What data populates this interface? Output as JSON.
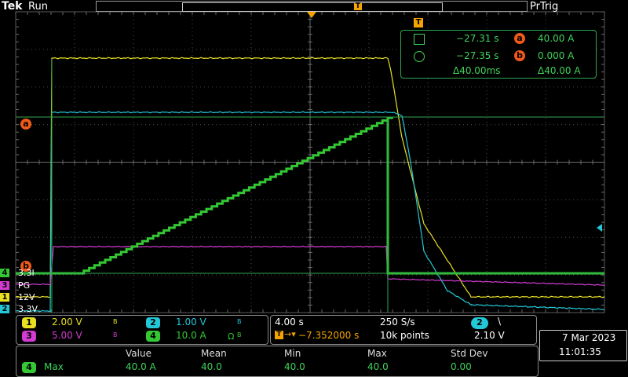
{
  "header": {
    "brand": "Tek",
    "run_state": "Run",
    "trigger_state": "PrTrig",
    "trigger_marker": "T"
  },
  "cursors": {
    "trigger_marker": "T",
    "a_label": "a",
    "b_label": "b",
    "a_time": "−27.31 s",
    "b_time": "−27.35 s",
    "a_value": "40.00 A",
    "b_value": "0.000 A",
    "delta_time": "Δ40.00ms",
    "delta_value": "Δ40.00 A"
  },
  "channel_labels": [
    {
      "num": "4",
      "text": "3.3I",
      "color": "#34c834"
    },
    {
      "num": "3",
      "text": "PG",
      "color": "#d33bd3"
    },
    {
      "num": "1",
      "text": "12V",
      "color": "#e8e020"
    },
    {
      "num": "2",
      "text": "3.3V",
      "color": "#22c8d8"
    }
  ],
  "channel_settings": [
    {
      "num": "1",
      "value": "2.00 V",
      "bw": "B",
      "color": "#e8e020"
    },
    {
      "num": "2",
      "value": "1.00 V",
      "bw": "B",
      "color": "#22c8d8"
    },
    {
      "num": "3",
      "value": "5.00 V",
      "bw": "B",
      "color": "#d33bd3"
    },
    {
      "num": "4",
      "value": "10.0 A",
      "bw": "B",
      "color": "#34c834"
    }
  ],
  "timebase": {
    "scale": "4.00 s",
    "sample_rate": "250 S/s",
    "trigger_offset": "−7.352000 s",
    "record_length": "10k points",
    "trigger_source": "2",
    "trigger_slope": "\\",
    "trigger_level": "2.10 V",
    "trigger_marker": "T"
  },
  "datetime": {
    "date": "7 Mar  2023",
    "time": "11:01:35"
  },
  "measurement": {
    "channel": "4",
    "type": "Max",
    "headers": [
      "Value",
      "Mean",
      "Min",
      "Max",
      "Std Dev"
    ],
    "values": [
      "40.0 A",
      "40.0",
      "40.0",
      "40.0",
      "0.00"
    ]
  },
  "colors": {
    "ch1": "#e8e020",
    "ch2": "#22c8d8",
    "ch3": "#d33bd3",
    "ch4": "#34c834",
    "cursor": "#2fa84f",
    "cursor_badge": "#f05a1a",
    "trigger": "#f5a300"
  }
}
